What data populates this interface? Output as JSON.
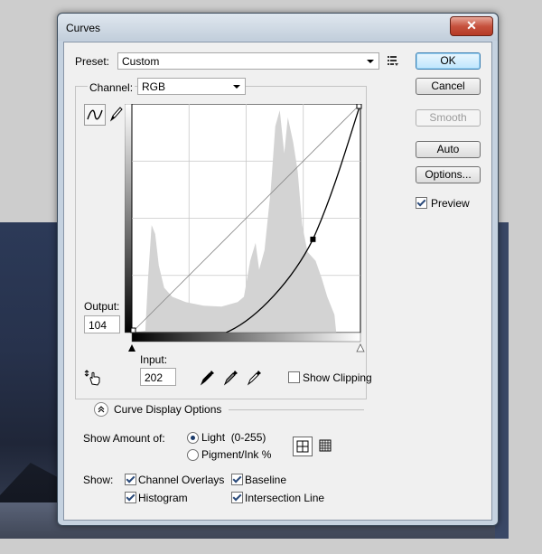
{
  "window": {
    "title": "Curves",
    "close_label": "✕"
  },
  "preset": {
    "label": "Preset:",
    "value": "Custom"
  },
  "channel": {
    "label": "Channel:",
    "value": "RGB"
  },
  "buttons": {
    "ok": "OK",
    "cancel": "Cancel",
    "smooth": "Smooth",
    "auto": "Auto",
    "options": "Options..."
  },
  "preview": {
    "label": "Preview",
    "checked": true
  },
  "output": {
    "label": "Output:",
    "value": "104"
  },
  "input": {
    "label": "Input:",
    "value": "202"
  },
  "show_clipping": {
    "label": "Show Clipping",
    "checked": false
  },
  "curve_display": {
    "label": "Curve Display Options"
  },
  "show_amount": {
    "label": "Show Amount of:",
    "light": "Light  (0-255)",
    "pigment": "Pigment/Ink %",
    "selected": "light"
  },
  "show": {
    "label": "Show:",
    "channel_overlays": {
      "label": "Channel Overlays",
      "checked": true
    },
    "baseline": {
      "label": "Baseline",
      "checked": true
    },
    "histogram": {
      "label": "Histogram",
      "checked": true
    },
    "intersection_line": {
      "label": "Intersection Line",
      "checked": true
    }
  },
  "colors": {
    "accent": "#3c7fb1",
    "histogram": "#d3d3d3",
    "close": "#c6523e"
  },
  "curve": {
    "points": [
      [
        0,
        0
      ],
      [
        202,
        104
      ],
      [
        255,
        255
      ]
    ],
    "active_point": [
      202,
      104
    ]
  }
}
